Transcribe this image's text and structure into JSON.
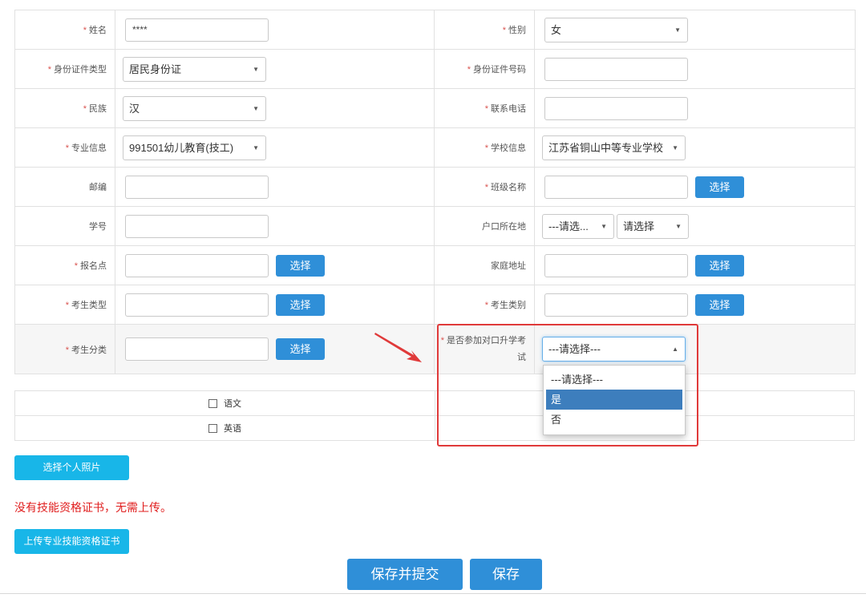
{
  "form": {
    "name": {
      "label": "姓名",
      "value": "****"
    },
    "gender": {
      "label": "性别",
      "value": "女"
    },
    "id_type": {
      "label": "身份证件类型",
      "value": "居民身份证"
    },
    "id_number": {
      "label": "身份证件号码",
      "value": ""
    },
    "ethnicity": {
      "label": "民族",
      "value": "汉"
    },
    "phone": {
      "label": "联系电话",
      "value": ""
    },
    "major": {
      "label": "专业信息",
      "value": "991501幼儿教育(技工)"
    },
    "school": {
      "label": "学校信息",
      "value": "江苏省铜山中等专业学校"
    },
    "postcode": {
      "label": "邮编",
      "value": ""
    },
    "class_name": {
      "label": "班级名称",
      "value": ""
    },
    "student_no": {
      "label": "学号",
      "value": ""
    },
    "household": {
      "label": "户口所在地",
      "value1": "---请选...",
      "value2": "请选择"
    },
    "registration_point": {
      "label": "报名点",
      "value": ""
    },
    "home_address": {
      "label": "家庭地址",
      "value": ""
    },
    "exam_type": {
      "label": "考生类型",
      "value": ""
    },
    "exam_category": {
      "label": "考生类别",
      "value": ""
    },
    "exam_classification": {
      "label": "考生分类",
      "value": ""
    },
    "join_exam": {
      "label_line1": "是否参加对口升学考",
      "label_line2": "试",
      "value": "---请选择---"
    },
    "choose_label": "选择",
    "required_mark": "*"
  },
  "dropdown": {
    "options": [
      "---请选择---",
      "是",
      "否"
    ],
    "highlighted_index": 1
  },
  "subjects": [
    "语文",
    "英语"
  ],
  "buttons": {
    "photo": "选择个人照片",
    "upload_cert": "上传专业技能资格证书",
    "save_submit": "保存并提交",
    "save": "保存"
  },
  "notice": "没有技能资格证书，无需上传。",
  "colors": {
    "required": "#d9534f",
    "primary_button": "#2f8fd8",
    "cyan_button": "#18b6e8",
    "notice_text": "#e01e1e",
    "annotation": "#e03a3a",
    "option_highlight": "#3d7ebd"
  },
  "icons": {
    "select_arrow": "triangle-down-icon",
    "annotation_arrow": "red-arrow-icon",
    "checkbox": "checkbox-icon"
  }
}
